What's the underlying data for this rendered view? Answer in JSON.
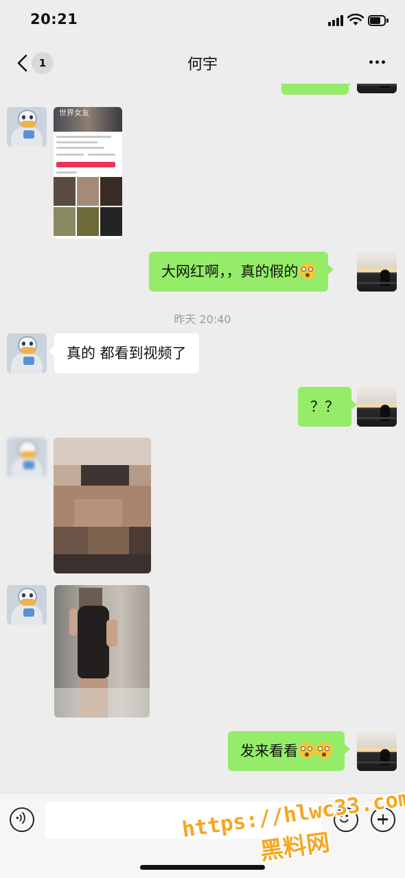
{
  "status_bar": {
    "time": "20:21",
    "icons": [
      "signal-icon",
      "wifi-icon",
      "battery-icon"
    ]
  },
  "nav": {
    "title": "何宇",
    "unread_count": "1",
    "back_icon": "chevron-left-icon",
    "more_icon": "more-dots-icon"
  },
  "messages": [
    {
      "side": "in",
      "type": "image",
      "description_icon": "screenshot-thumbnail"
    },
    {
      "side": "out",
      "type": "text",
      "text": "大网红啊，，真的假的",
      "emoji": "flushed-face"
    },
    {
      "side": "in",
      "type": "text",
      "text": "真的 都看到视频了"
    },
    {
      "side": "out",
      "type": "text",
      "text": "？？"
    },
    {
      "side": "in",
      "type": "image"
    },
    {
      "side": "in",
      "type": "image"
    },
    {
      "side": "out",
      "type": "text",
      "text": "发来看看",
      "emoji": "flushed-face"
    }
  ],
  "timestamp": "昨天 20:40",
  "thumbnail": {
    "banner_text": "世界女友",
    "follow_label": "+ 关注"
  },
  "input_bar": {
    "placeholder": "",
    "icons": [
      "voice-icon",
      "emoji-icon",
      "plus-icon"
    ]
  },
  "watermark": {
    "line1": "https://hlwc33.com",
    "line2": "黑料网"
  },
  "colors": {
    "background": "#ededed",
    "outgoing_bubble": "#95ec69",
    "incoming_bubble": "#ffffff",
    "watermark": "#f5a623"
  }
}
